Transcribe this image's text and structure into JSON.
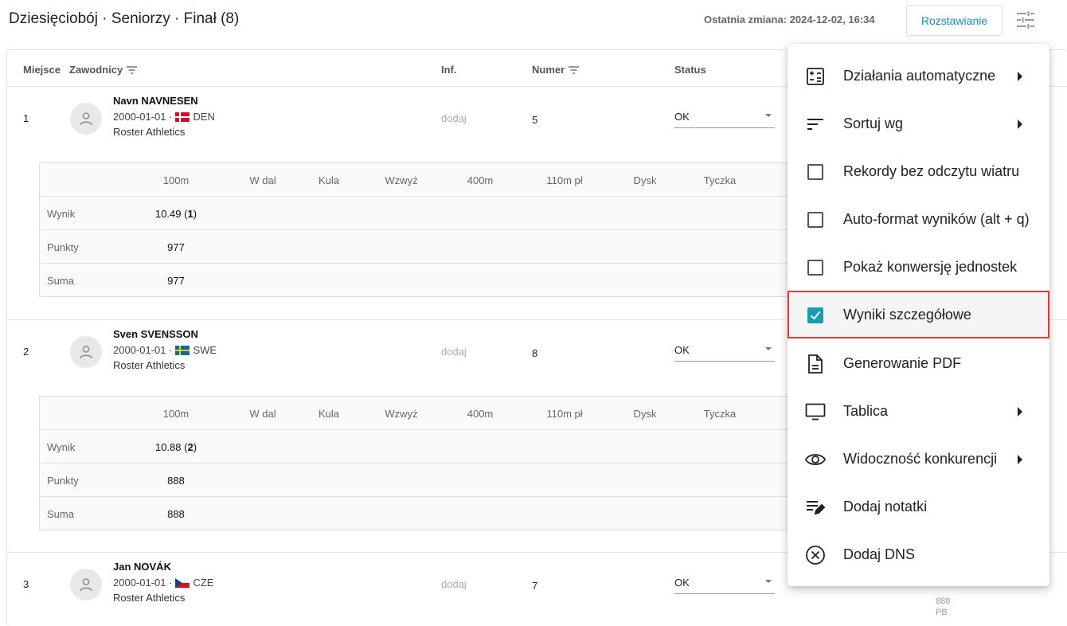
{
  "header": {
    "title": "Dziesięciobój · Seniorzy · Finał (8)",
    "last_change_label": "Ostatnia zmiana:",
    "last_change_value": "2024-12-02, 16:34",
    "seed_button": "Rozstawianie",
    "settings_icon": "tune-icon"
  },
  "table": {
    "columns": {
      "place": "Miejsce",
      "athletes": "Zawodnicy",
      "inf": "Inf.",
      "number": "Numer",
      "status": "Status"
    },
    "events": [
      "100m",
      "W dal",
      "Kula",
      "Wzwyż",
      "400m",
      "110m pł",
      "Dysk",
      "Tyczka"
    ],
    "row_labels": {
      "result": "Wynik",
      "points": "Punkty",
      "sum": "Suma"
    },
    "athletes": [
      {
        "place": "1",
        "name": "Navn NAVNESEN",
        "dob": "2000-01-01 ·",
        "country": "DEN",
        "club": "Roster Athletics",
        "inf": "dodaj",
        "number": "5",
        "status": "OK",
        "result": "10.49",
        "rank": "1",
        "points": "977",
        "sum": "977"
      },
      {
        "place": "2",
        "name": "Sven SVENSSON",
        "dob": "2000-01-01 ·",
        "country": "SWE",
        "club": "Roster Athletics",
        "inf": "dodaj",
        "number": "8",
        "status": "OK",
        "result": "10.88",
        "rank": "2",
        "points": "888",
        "sum": "888"
      },
      {
        "place": "3",
        "name": "Jan NOVÁK",
        "dob": "2000-01-01 ·",
        "country": "CZE",
        "club": "Roster Athletics",
        "inf": "dodaj",
        "number": "7",
        "status": "OK"
      }
    ],
    "partial_pb": "PB",
    "partial_value": "888"
  },
  "menu": {
    "items": [
      {
        "label": "Działania automatyczne",
        "icon": "calculator-icon",
        "submenu": true
      },
      {
        "label": "Sortuj wg",
        "icon": "sort-icon",
        "submenu": true
      },
      {
        "label": "Rekordy bez odczytu wiatru",
        "icon": "checkbox-icon",
        "checked": false
      },
      {
        "label": "Auto-format wyników (alt + q)",
        "icon": "checkbox-icon",
        "checked": false
      },
      {
        "label": "Pokaż konwersję jednostek",
        "icon": "checkbox-icon",
        "checked": false
      },
      {
        "label": "Wyniki szczegółowe",
        "icon": "checkbox-icon",
        "checked": true,
        "highlighted": true
      },
      {
        "label": "Generowanie PDF",
        "icon": "document-icon"
      },
      {
        "label": "Tablica",
        "icon": "monitor-icon",
        "submenu": true
      },
      {
        "label": "Widoczność konkurencji",
        "icon": "eye-icon",
        "submenu": true
      },
      {
        "label": "Dodaj notatki",
        "icon": "edit-note-icon"
      },
      {
        "label": "Dodaj DNS",
        "icon": "cancel-circle-icon"
      }
    ]
  },
  "colors": {
    "accent": "#1a9bb3",
    "highlight_border": "#e53935"
  }
}
